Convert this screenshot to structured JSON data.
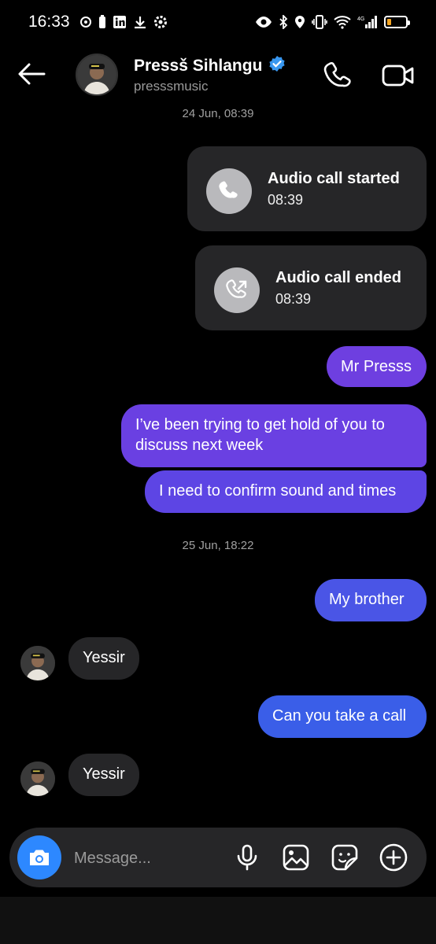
{
  "status_bar": {
    "time": "16:33",
    "network": "4G"
  },
  "header": {
    "name": "Pressš Sihlangu",
    "username": "presssmusic",
    "verified": true
  },
  "thread": {
    "timestamps": [
      "24 Jun, 08:39",
      "25 Jun, 18:22"
    ],
    "calls": [
      {
        "title": "Audio call started",
        "time": "08:39"
      },
      {
        "title": "Audio call ended",
        "time": "08:39"
      }
    ],
    "messages": [
      {
        "text": "Mr Presss",
        "from": "me"
      },
      {
        "text": "I’ve been trying to get hold of you to discuss next week",
        "from": "me"
      },
      {
        "text": "I need to confirm sound and times",
        "from": "me"
      },
      {
        "text": "My brother",
        "from": "me"
      },
      {
        "text": "Yessir",
        "from": "them"
      },
      {
        "text": "Can you take a call",
        "from": "me"
      },
      {
        "text": "Yessir",
        "from": "them"
      }
    ]
  },
  "composer": {
    "placeholder": "Message..."
  },
  "colors": {
    "accent_purple": "#6e3fe0",
    "accent_indigo": "#5946e6",
    "accent_blue": "#3a5ee8",
    "camera_blue": "#2d88ff",
    "verified_blue": "#3897f0",
    "incoming_bubble": "#262628"
  }
}
